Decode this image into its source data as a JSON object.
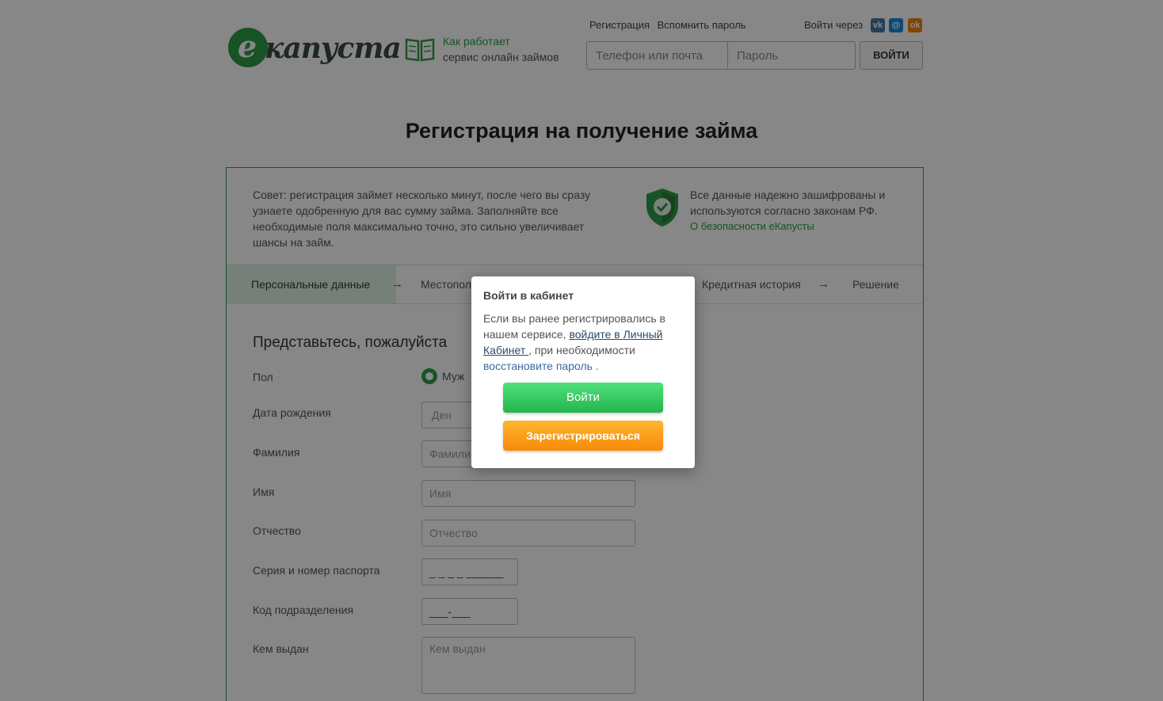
{
  "header": {
    "logo_letter": "е",
    "logo_text": "капуста",
    "how_line1": "Как работает",
    "how_line2": "сервис онлайн займов",
    "links": [
      "Регистрация",
      "Вспомнить пароль"
    ],
    "login_via": "Войти через",
    "social": {
      "vk": "vk",
      "mail": "@",
      "ok": "ok"
    },
    "phone_placeholder": "Телефон или почта",
    "password_placeholder": "Пароль",
    "login_button": "ВОЙТИ"
  },
  "page": {
    "title": "Регистрация на получение займа",
    "tip": "Совет: регистрация займет несколько минут, после чего вы сразу узнаете одобренную для вас сумму займа. Заполняйте все необходимые поля максимально точно, это сильно увеличивает шансы на займ.",
    "security_text": "Все данные надежно зашифрованы и используются согласно законам РФ.",
    "security_link": "О безопасности еКапусты",
    "steps": [
      "Персональные данные",
      "Местопол",
      "Кредитная история",
      "Решение"
    ],
    "arrow": "→",
    "section_title": "Представьтесь, пожалуйста",
    "form": {
      "gender_label": "Пол",
      "gender_option": "Муж",
      "birth_label": "Дата рождения",
      "birth_day_placeholder": "Ден",
      "surname_label": "Фамилия",
      "surname_placeholder": "Фамили",
      "name_label": "Имя",
      "name_placeholder": "Имя",
      "patronymic_label": "Отчество",
      "patronymic_placeholder": "Отчество",
      "passport_label": "Серия и номер паспорта",
      "passport_mask": "_ _ _ _ ______",
      "division_label": "Код подразделения",
      "division_mask": "___-___",
      "issued_label": "Кем выдан",
      "issued_placeholder": "Кем выдан"
    }
  },
  "modal": {
    "title": "Войти в кабинет",
    "text_1": "Если вы ранее регистрировались в нашем сервисе, ",
    "link_cabinet": "войдите в Личный Кабинет ",
    "text_2": ", при необходимости ",
    "link_restore": "восстановите пароль",
    "text_3": " .",
    "enter_button": "Войти",
    "register_button": "Зарегистрироваться"
  },
  "colors": {
    "brand_green": "#2f9e47",
    "button_green": "#34c85a",
    "button_orange": "#fb9a14",
    "overlay": "rgba(0,0,0,0.47)"
  }
}
